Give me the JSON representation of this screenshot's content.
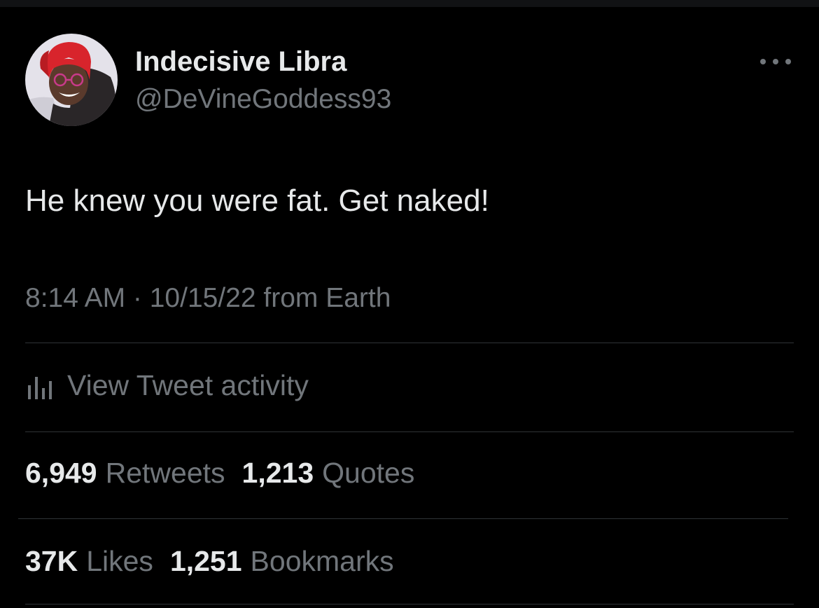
{
  "tweet": {
    "author_name": "Indecisive Libra",
    "author_handle": "@DeVineGoddess93",
    "text": "He knew you were fat. Get naked!",
    "timestamp": "8:14 AM · 10/15/22 from Earth",
    "more_icon": "more-horizontal-icon",
    "avatar_icon": "avatar"
  },
  "activity": {
    "icon": "bar-chart-icon",
    "label": "View Tweet activity"
  },
  "stats": {
    "retweets": {
      "count": "6,949",
      "label": "Retweets"
    },
    "quotes": {
      "count": "1,213",
      "label": "Quotes"
    },
    "likes": {
      "count": "37K",
      "label": "Likes"
    },
    "bookmarks": {
      "count": "1,251",
      "label": "Bookmarks"
    }
  },
  "colors": {
    "background": "#000000",
    "primary_text": "#e7e9ea",
    "secondary_text": "#71767b",
    "divider": "#2f3336",
    "avatar_hair": "#d8242c"
  }
}
